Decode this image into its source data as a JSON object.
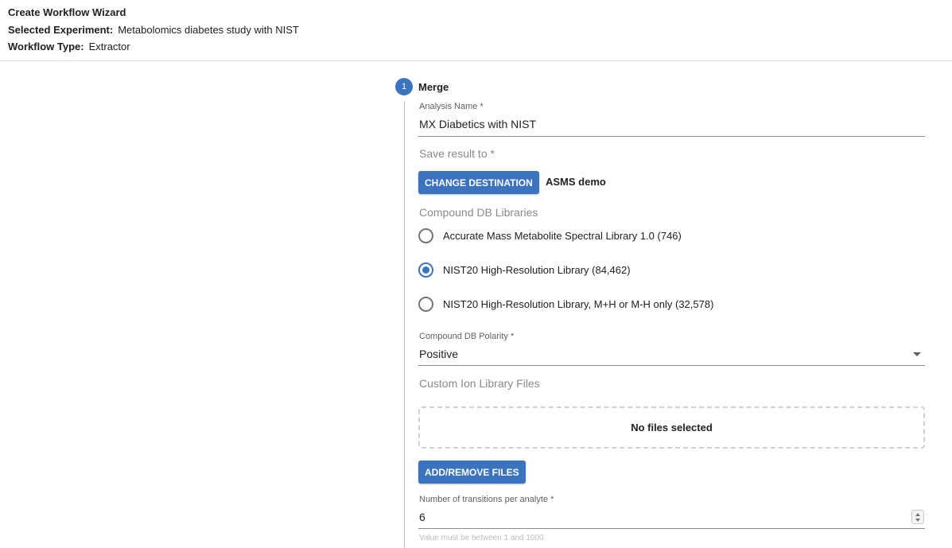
{
  "header": {
    "title": "Create Workflow Wizard",
    "experiment_label": "Selected Experiment:",
    "experiment_value": "Metabolomics diabetes study with NIST",
    "workflow_type_label": "Workflow Type:",
    "workflow_type_value": "Extractor"
  },
  "step": {
    "number": "1",
    "title": "Merge"
  },
  "analysis_name": {
    "label": "Analysis Name *",
    "value": "MX Diabetics with NIST"
  },
  "save_result": {
    "label": "Save result to *",
    "button_label": "CHANGE DESTINATION",
    "destination": "ASMS demo"
  },
  "compound_db": {
    "label": "Compound DB Libraries",
    "options": [
      {
        "label": "Accurate Mass Metabolite Spectral Library 1.0 (746)",
        "checked": false
      },
      {
        "label": "NIST20 High-Resolution Library (84,462)",
        "checked": true
      },
      {
        "label": "NIST20 High-Resolution Library, M+H or M-H only (32,578)",
        "checked": false
      }
    ]
  },
  "polarity": {
    "label": "Compound DB Polarity *",
    "value": "Positive"
  },
  "custom_ion": {
    "label": "Custom Ion Library Files",
    "empty_text": "No files selected",
    "button_label": "ADD/REMOVE FILES"
  },
  "transitions": {
    "label": "Number of transitions per analyte *",
    "value": "6",
    "hint": "Value must be between 1 and 1000"
  },
  "colors": {
    "primary": "#3b73be",
    "divider": "#e0e0e0"
  }
}
